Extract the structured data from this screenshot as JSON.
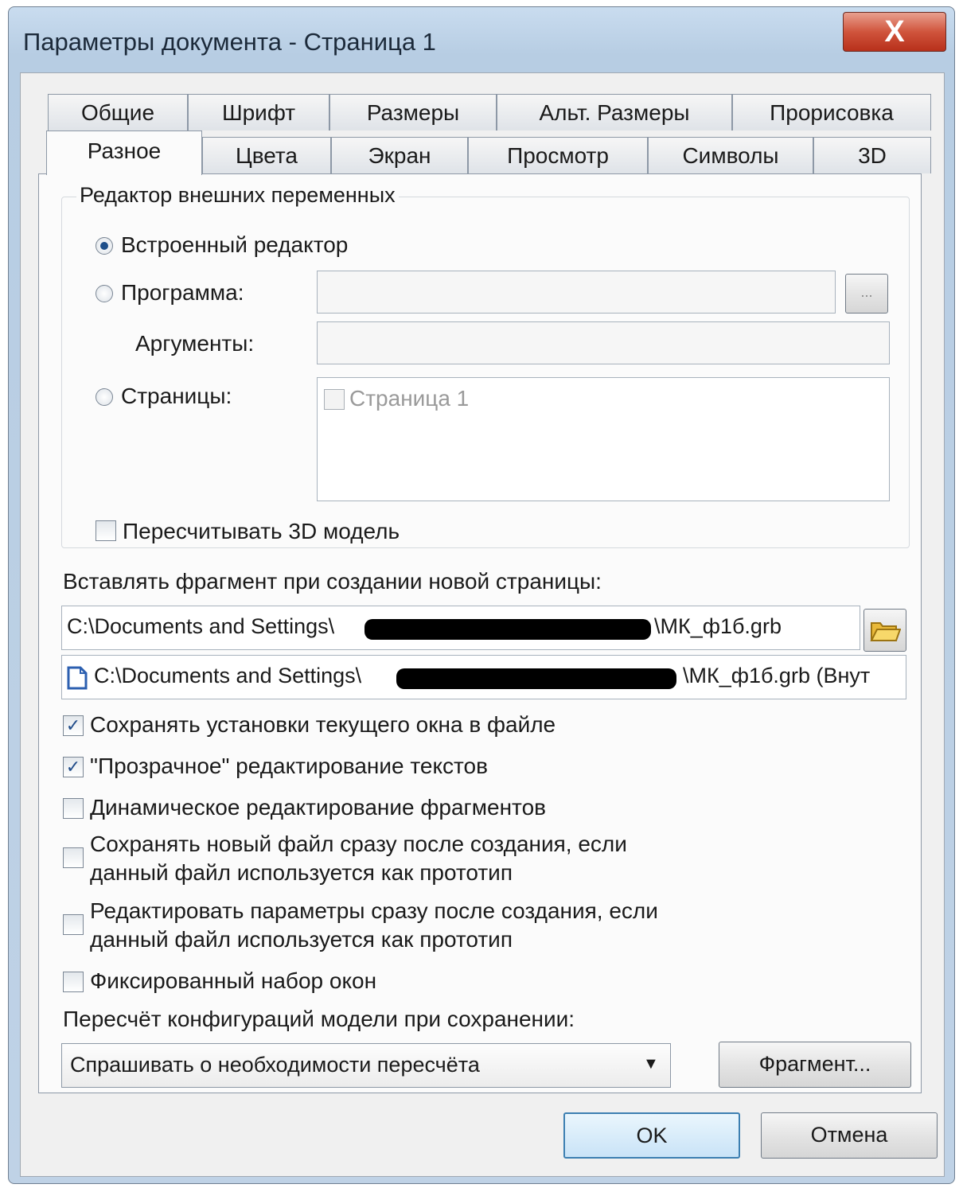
{
  "window": {
    "title": "Параметры документа - Страница 1",
    "close_label": "X"
  },
  "tabs": {
    "row1": [
      "Общие",
      "Шрифт",
      "Размеры",
      "Альт. Размеры",
      "Прорисовка"
    ],
    "row2": [
      "Разное",
      "Цвета",
      "Экран",
      "Просмотр",
      "Символы",
      "3D"
    ],
    "active": "Разное"
  },
  "external_editor": {
    "group_label": "Редактор внешних переменных",
    "builtin_label": "Встроенный редактор",
    "builtin_checked": true,
    "program_label": "Программа:",
    "program_value": "",
    "browse_label": "...",
    "arguments_label": "Аргументы:",
    "arguments_value": "",
    "pages_label": "Страницы:",
    "pages_items": [
      "Страница 1"
    ],
    "recalc_3d_label": "Пересчитывать 3D модель"
  },
  "fragment": {
    "label": "Вставлять фрагмент при создании новой страницы:",
    "path_prefix": "C:\\Documents and Settings\\",
    "path_suffix": "\\МК_ф1б.grb",
    "path2_prefix": "C:\\Documents and Settings\\",
    "path2_suffix": "\\МК_ф1б.grb (Внут"
  },
  "options": [
    {
      "label": "Сохранять установки текущего окна в файле",
      "checked": true
    },
    {
      "label": "\"Прозрачное\" редактирование текстов",
      "checked": true
    },
    {
      "label": "Динамическое редактирование фрагментов",
      "checked": false
    },
    {
      "label": "Сохранять новый файл сразу после создания, если",
      "label2": "данный файл используется как прототип",
      "checked": false
    },
    {
      "label": "Редактировать параметры сразу после создания, если",
      "label2": "данный файл используется как прототип",
      "checked": false
    },
    {
      "label": "Фиксированный набор окон",
      "checked": false
    }
  ],
  "recalc": {
    "label": "Пересчёт конфигураций модели при сохранении:",
    "selected": "Спрашивать о необходимости пересчёта",
    "fragment_button": "Фрагмент..."
  },
  "footer": {
    "ok": "OK",
    "cancel": "Отмена"
  },
  "colors": {
    "title_bar": "#c9dcef",
    "close_button": "#d0543c",
    "radio_selected": "#1f4f8a",
    "check_mark": "#214d8a"
  }
}
